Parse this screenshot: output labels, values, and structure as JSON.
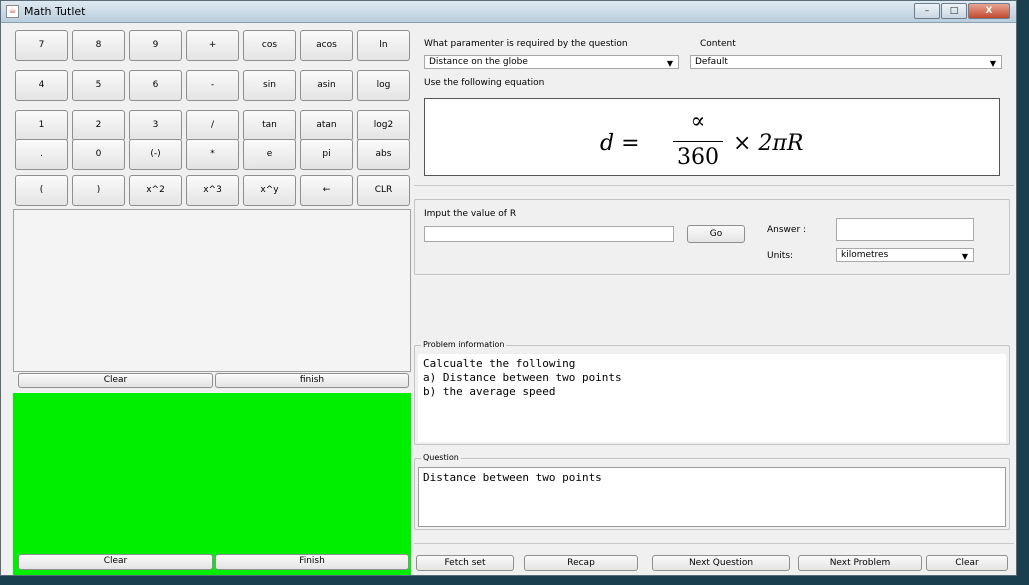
{
  "window": {
    "title": "Math Tutlet",
    "minimize": "–",
    "maximize": "□",
    "close": "X"
  },
  "calculator": {
    "rows": [
      [
        "7",
        "8",
        "9",
        "+",
        "cos",
        "acos",
        "ln"
      ],
      [
        "4",
        "5",
        "6",
        "-",
        "sin",
        "asin",
        "log"
      ],
      [
        "1",
        "2",
        "3",
        "/",
        "tan",
        "atan",
        "log2"
      ],
      [
        ".",
        "0",
        "(-)",
        "*",
        "e",
        "pi",
        "abs"
      ],
      [
        "(",
        ")",
        "x^2",
        "x^3",
        "x^y",
        "←",
        "CLR"
      ]
    ]
  },
  "work_area": {
    "clear_label": "Clear",
    "finish_label": "finish"
  },
  "green_area": {
    "clear_label": "Clear",
    "finish_label": "Finish",
    "color": "#00ee00"
  },
  "question_params": {
    "param_label": "What paramenter is required by the question",
    "param_value": "Distance on the globe",
    "content_label": "Content",
    "content_value": "Default",
    "equation_label": "Use the following equation",
    "equation": {
      "lhs": "d =",
      "numerator": "∝",
      "denominator": "360",
      "rhs": "× 2πR"
    }
  },
  "input_section": {
    "prompt": "Imput the value of R",
    "value": "",
    "go_label": "Go",
    "answer_label": "Answer :",
    "answer_value": "",
    "units_label": "Units:",
    "units_value": "kilometres"
  },
  "problem_info": {
    "legend": "Problem information",
    "lines": [
      "Calcualte the following",
      "a) Distance between two points",
      "b) the average speed"
    ]
  },
  "question": {
    "legend": "Question",
    "text": "Distance between two points"
  },
  "bottom_buttons": [
    "Fetch set",
    "Recap",
    "Next Question",
    "Next Problem",
    "Clear"
  ]
}
